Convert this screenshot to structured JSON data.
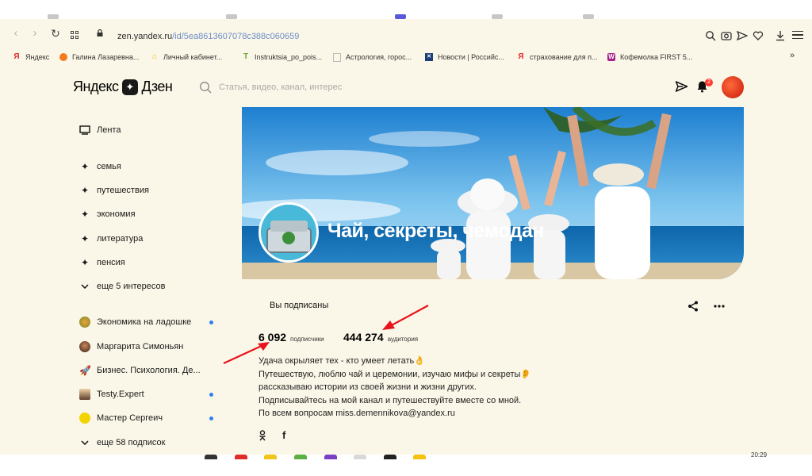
{
  "browser": {
    "url_host": "zen.yandex.ru",
    "url_path": "/id/5ea8613607078c388c060659"
  },
  "bookmarks": [
    {
      "label": "Яндекс",
      "icon": "yandex-y-icon",
      "color": "#e02b2b"
    },
    {
      "label": "Галина Лазаревна...",
      "icon": "ok-orange-icon",
      "color": "#f47a1f"
    },
    {
      "label": "Личный кабинет...",
      "icon": "house-icon",
      "color": "#f5b50a"
    },
    {
      "label": "Instruktsia_po_pois...",
      "icon": "t-icon",
      "color": "#8cc63f"
    },
    {
      "label": "Астрология, горос...",
      "icon": "page-icon",
      "color": "#bbbbbb"
    },
    {
      "label": "Новости | Российс...",
      "icon": "news-icon",
      "color": "#1d3c75"
    },
    {
      "label": "страхование для п...",
      "icon": "yandex-y-icon",
      "color": "#e02b2b"
    },
    {
      "label": "Кофемолка FIRST 5...",
      "icon": "w-icon",
      "color": "#a4228e"
    }
  ],
  "header": {
    "logo_left": "Яндекс",
    "logo_right": "Дзен",
    "search_placeholder": "Статья, видео, канал, интерес",
    "notifications_count": "2"
  },
  "sidebar": {
    "feed": "Лента",
    "interests": [
      "семья",
      "путешествия",
      "экономия",
      "литература",
      "пенсия"
    ],
    "more_interests": "еще 5 интересов",
    "subscriptions": [
      {
        "label": "Экономика на ладошке",
        "dot": true
      },
      {
        "label": "Маргарита Симоньян",
        "dot": false
      },
      {
        "label": "Бизнес. Психология. Де...",
        "dot": false
      },
      {
        "label": "Testy.Expert",
        "dot": true
      },
      {
        "label": "Мастер Сергеич",
        "dot": true
      }
    ],
    "more_subscriptions": "еще 58 подписок"
  },
  "channel": {
    "title": "Чай, секреты, чемодан",
    "subscribed_label": "Вы подписаны",
    "subscribers": "6 092",
    "subscribers_label": "подписчики",
    "audience": "444 274",
    "audience_label": "аудитория",
    "description": [
      "Удача окрыляет тех - кто умеет летать👌",
      "Путешествую, люблю чай и церемонии, изучаю мифы и секреты👂",
      "рассказываю истории из своей жизни и жизни других.",
      "Подписывайтесь на мой канал и путешествуйте вместе со мной.",
      "По всем вопросам miss.demennikova@yandex.ru"
    ],
    "social_fb": "f"
  },
  "taskbar": {
    "clock": "20:29"
  },
  "colors": {
    "page_bg": "#fbf7e8",
    "accent_blue": "#2b7ff0",
    "annotation_arrow": "#e8131b"
  }
}
